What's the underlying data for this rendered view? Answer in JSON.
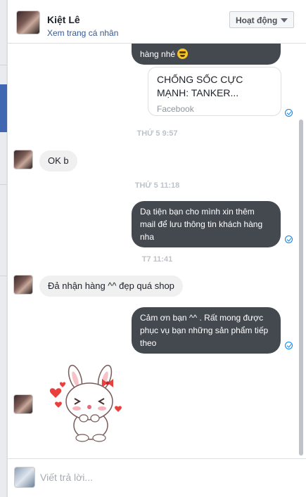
{
  "header": {
    "contact_name": "Kiệt Lê",
    "profile_link": "Xem trang cá nhân",
    "status_label": "Hoạt động"
  },
  "messages": {
    "partial_top": "hàng nhé",
    "link_card": {
      "title": "CHỐNG SỐC CỰC MẠNH: TANKER...",
      "source": "Facebook"
    },
    "time_1": "THỨ 5 9:57",
    "in_1": "OK b",
    "time_2": "THỨ 5 11:18",
    "out_1": "Dạ tiện bạn cho mình xin thêm mail để lưu thông tin khách hàng nha",
    "time_3": "T7 11:41",
    "in_2": "Đả nhận hàng ^^ đẹp quá shop",
    "out_2": "Cảm ơn bạn ^^ . Rất mong được phục vụ bạn những sản phẩm tiếp theo"
  },
  "composer": {
    "placeholder": "Viết trả lời..."
  },
  "colors": {
    "outgoing_bubble": "#444950",
    "incoming_bubble": "#f1f0f0",
    "link": "#365899",
    "seen": "#0084ff"
  },
  "icons": {
    "seen": "seen-check-icon",
    "dropdown": "chevron-down-icon",
    "sticker": "bunny-sticker"
  }
}
